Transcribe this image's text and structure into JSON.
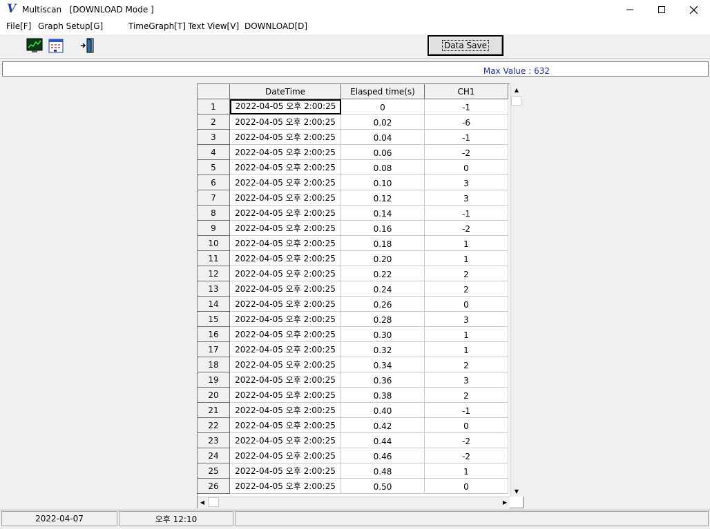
{
  "window": {
    "title": "Multiscan   [DOWNLOAD Mode ]",
    "logo": "V",
    "controls": [
      "minimize-icon",
      "maximize-icon",
      "close-icon"
    ]
  },
  "menu": {
    "items": [
      {
        "label": "File[F]"
      },
      {
        "label": "Graph Setup[G]"
      },
      {
        "label": "TimeGraph[T]"
      },
      {
        "label": "Text View[V]"
      },
      {
        "label": "DOWNLOAD[D]"
      }
    ]
  },
  "toolbar": {
    "icons": [
      "graph-monitor-icon",
      "calendar-icon",
      "exit-door-icon"
    ],
    "data_save_label": "Data Save"
  },
  "info": {
    "max_value": "Max Value : 632"
  },
  "grid": {
    "headers": [
      "DateTime",
      "Elasped time(s)",
      "CH1"
    ],
    "rows": [
      {
        "n": "1",
        "dt": "2022-04-05 오후 2:00:25",
        "el": "0",
        "ch": "-1"
      },
      {
        "n": "2",
        "dt": "2022-04-05 오후 2:00:25",
        "el": "0.02",
        "ch": "-6"
      },
      {
        "n": "3",
        "dt": "2022-04-05 오후 2:00:25",
        "el": "0.04",
        "ch": "-1"
      },
      {
        "n": "4",
        "dt": "2022-04-05 오후 2:00:25",
        "el": "0.06",
        "ch": "-2"
      },
      {
        "n": "5",
        "dt": "2022-04-05 오후 2:00:25",
        "el": "0.08",
        "ch": "0"
      },
      {
        "n": "6",
        "dt": "2022-04-05 오후 2:00:25",
        "el": "0.10",
        "ch": "3"
      },
      {
        "n": "7",
        "dt": "2022-04-05 오후 2:00:25",
        "el": "0.12",
        "ch": "3"
      },
      {
        "n": "8",
        "dt": "2022-04-05 오후 2:00:25",
        "el": "0.14",
        "ch": "-1"
      },
      {
        "n": "9",
        "dt": "2022-04-05 오후 2:00:25",
        "el": "0.16",
        "ch": "-2"
      },
      {
        "n": "10",
        "dt": "2022-04-05 오후 2:00:25",
        "el": "0.18",
        "ch": "1"
      },
      {
        "n": "11",
        "dt": "2022-04-05 오후 2:00:25",
        "el": "0.20",
        "ch": "1"
      },
      {
        "n": "12",
        "dt": "2022-04-05 오후 2:00:25",
        "el": "0.22",
        "ch": "2"
      },
      {
        "n": "13",
        "dt": "2022-04-05 오후 2:00:25",
        "el": "0.24",
        "ch": "2"
      },
      {
        "n": "14",
        "dt": "2022-04-05 오후 2:00:25",
        "el": "0.26",
        "ch": "0"
      },
      {
        "n": "15",
        "dt": "2022-04-05 오후 2:00:25",
        "el": "0.28",
        "ch": "3"
      },
      {
        "n": "16",
        "dt": "2022-04-05 오후 2:00:25",
        "el": "0.30",
        "ch": "1"
      },
      {
        "n": "17",
        "dt": "2022-04-05 오후 2:00:25",
        "el": "0.32",
        "ch": "1"
      },
      {
        "n": "18",
        "dt": "2022-04-05 오후 2:00:25",
        "el": "0.34",
        "ch": "2"
      },
      {
        "n": "19",
        "dt": "2022-04-05 오후 2:00:25",
        "el": "0.36",
        "ch": "3"
      },
      {
        "n": "20",
        "dt": "2022-04-05 오후 2:00:25",
        "el": "0.38",
        "ch": "2"
      },
      {
        "n": "21",
        "dt": "2022-04-05 오후 2:00:25",
        "el": "0.40",
        "ch": "-1"
      },
      {
        "n": "22",
        "dt": "2022-04-05 오후 2:00:25",
        "el": "0.42",
        "ch": "0"
      },
      {
        "n": "23",
        "dt": "2022-04-05 오후 2:00:25",
        "el": "0.44",
        "ch": "-2"
      },
      {
        "n": "24",
        "dt": "2022-04-05 오후 2:00:25",
        "el": "0.46",
        "ch": "-2"
      },
      {
        "n": "25",
        "dt": "2022-04-05 오후 2:00:25",
        "el": "0.48",
        "ch": "1"
      },
      {
        "n": "26",
        "dt": "2022-04-05 오후 2:00:25",
        "el": "0.50",
        "ch": "0"
      }
    ]
  },
  "status": {
    "date": "2022-04-07",
    "time": "오후 12:10"
  },
  "colors": {
    "max_value_text": "#1b2bb5",
    "logo": "#1f3fb5"
  }
}
